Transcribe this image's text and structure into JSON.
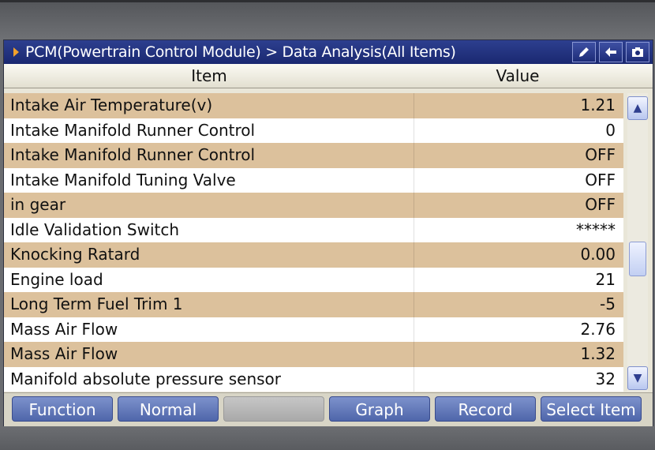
{
  "titlebar": {
    "title": "PCM(Powertrain Control Module) > Data Analysis(All Items)",
    "icons": [
      "pencil-icon",
      "back-arrow-icon",
      "camera-icon"
    ]
  },
  "table": {
    "headers": {
      "item": "Item",
      "value": "Value"
    },
    "rows": [
      {
        "name": "Intake Air Temperature(v)",
        "value": "1.21"
      },
      {
        "name": "Intake Manifold Runner Control",
        "value": "0"
      },
      {
        "name": "Intake Manifold Runner Control",
        "value": "OFF"
      },
      {
        "name": "Intake Manifold Tuning Valve",
        "value": "OFF"
      },
      {
        "name": "in gear",
        "value": "OFF"
      },
      {
        "name": "Idle Validation Switch",
        "value": "*****"
      },
      {
        "name": "Knocking Ratard",
        "value": "0.00"
      },
      {
        "name": "Engine load",
        "value": "21"
      },
      {
        "name": "Long Term Fuel Trim 1",
        "value": "-5"
      },
      {
        "name": "Mass Air Flow",
        "value": "2.76"
      },
      {
        "name": "Mass Air Flow",
        "value": "1.32"
      },
      {
        "name": "Manifold absolute pressure sensor",
        "value": "32"
      }
    ]
  },
  "bottom_bar": {
    "buttons": [
      {
        "label": "Function",
        "enabled": true
      },
      {
        "label": "Normal",
        "enabled": true
      },
      {
        "label": "",
        "enabled": false
      },
      {
        "label": "Graph",
        "enabled": true
      },
      {
        "label": "Record",
        "enabled": true
      },
      {
        "label": "Select Item",
        "enabled": true
      }
    ]
  },
  "colors": {
    "titlebar": "#1f2d78",
    "row_shaded": "#dcc19c",
    "row_plain": "#ffffff",
    "button": "#5a70b3",
    "button_disabled": "#b5b5b5",
    "title_arrow": "#f2a12c"
  }
}
